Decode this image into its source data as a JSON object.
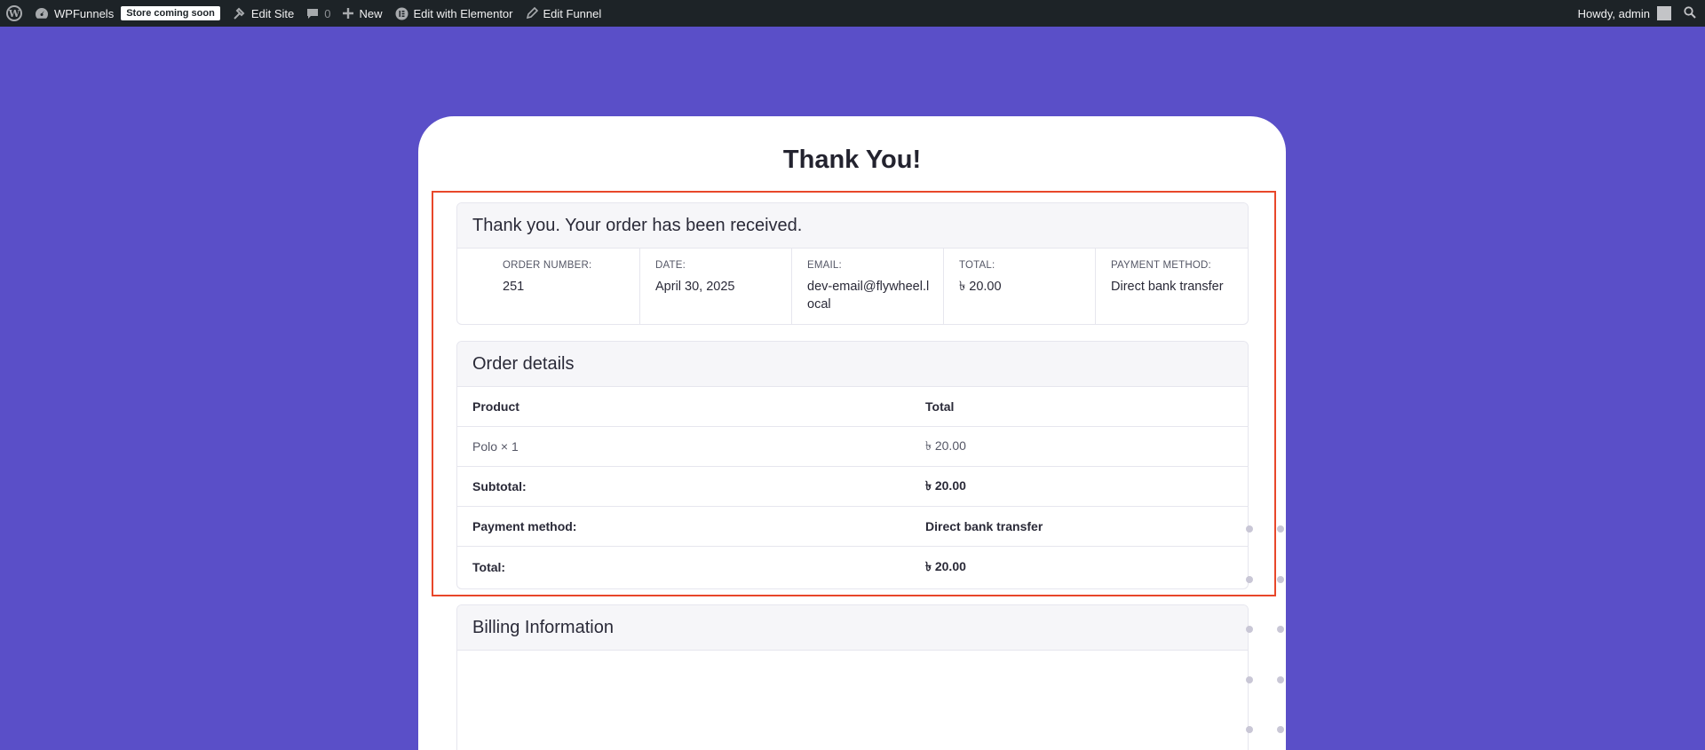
{
  "adminbar": {
    "site_name": "WPFunnels",
    "store_badge": "Store coming soon",
    "edit_site": "Edit Site",
    "comments_count": "0",
    "new_label": "New",
    "elementor_label": "Edit with Elementor",
    "edit_funnel": "Edit Funnel",
    "howdy": "Howdy, admin"
  },
  "page": {
    "title": "Thank You!"
  },
  "order_received": {
    "heading": "Thank you. Your order has been received.",
    "fields": [
      {
        "label": "ORDER NUMBER:",
        "value": "251"
      },
      {
        "label": "DATE:",
        "value": "April 30, 2025"
      },
      {
        "label": "EMAIL:",
        "value": "dev-email@flywheel.local"
      },
      {
        "label": "TOTAL:",
        "value": "৳ 20.00"
      },
      {
        "label": "PAYMENT METHOD:",
        "value": "Direct bank transfer"
      }
    ]
  },
  "order_details": {
    "heading": "Order details",
    "col_product": "Product",
    "col_total": "Total",
    "item_name": "Polo × 1",
    "item_total": "৳ 20.00",
    "subtotal_label": "Subtotal:",
    "subtotal_value": "৳ 20.00",
    "payment_label": "Payment method:",
    "payment_value": "Direct bank transfer",
    "total_label": "Total:",
    "total_value": "৳ 20.00"
  },
  "billing": {
    "heading": "Billing Information"
  },
  "colors": {
    "background": "#5a4fc8",
    "adminbar": "#1d2327",
    "highlight": "#e8472a"
  }
}
